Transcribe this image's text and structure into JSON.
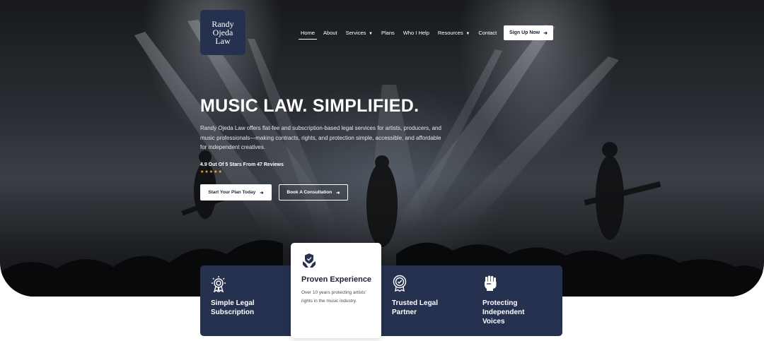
{
  "logo": {
    "line1": "Randy",
    "line2": "Ojeda",
    "line3": "Law"
  },
  "nav": {
    "items": [
      {
        "label": "Home",
        "active": true
      },
      {
        "label": "About"
      },
      {
        "label": "Services",
        "has_dropdown": true
      },
      {
        "label": "Plans"
      },
      {
        "label": "Who I Help"
      },
      {
        "label": "Resources",
        "has_dropdown": true
      },
      {
        "label": "Contact"
      }
    ],
    "signup_label": "Sign Up Now"
  },
  "hero": {
    "headline": "MUSIC LAW. SIMPLIFIED.",
    "description": "Randy Ojeda Law offers flat-fee and subscription-based legal services for artists, producers, and music professionals—making contracts, rights, and protection simple, accessible, and affordable for independent creatives.",
    "rating_text": "4.9 Out Of 5 Stars From 47 Reviews",
    "stars": "★★★★★",
    "primary_button": "Start Your Plan Today",
    "secondary_button": "Book A Consultation"
  },
  "features": [
    {
      "title_line1": "Simple Legal",
      "title_line2": "Subscription",
      "icon": "award-icon"
    },
    {
      "title": "Proven Experience",
      "text": "Over 10 years protecting artists' rights in the music industry.",
      "icon": "shield-hands-icon"
    },
    {
      "title_line1": "Trusted Legal",
      "title_line2": "Partner",
      "icon": "badge-check-icon"
    },
    {
      "title_line1": "Protecting",
      "title_line2": "Independent",
      "title_line3": "Voices",
      "icon": "raised-fist-icon"
    }
  ],
  "colors": {
    "navy": "#26314f",
    "star": "#f2b53b",
    "white": "#ffffff"
  }
}
